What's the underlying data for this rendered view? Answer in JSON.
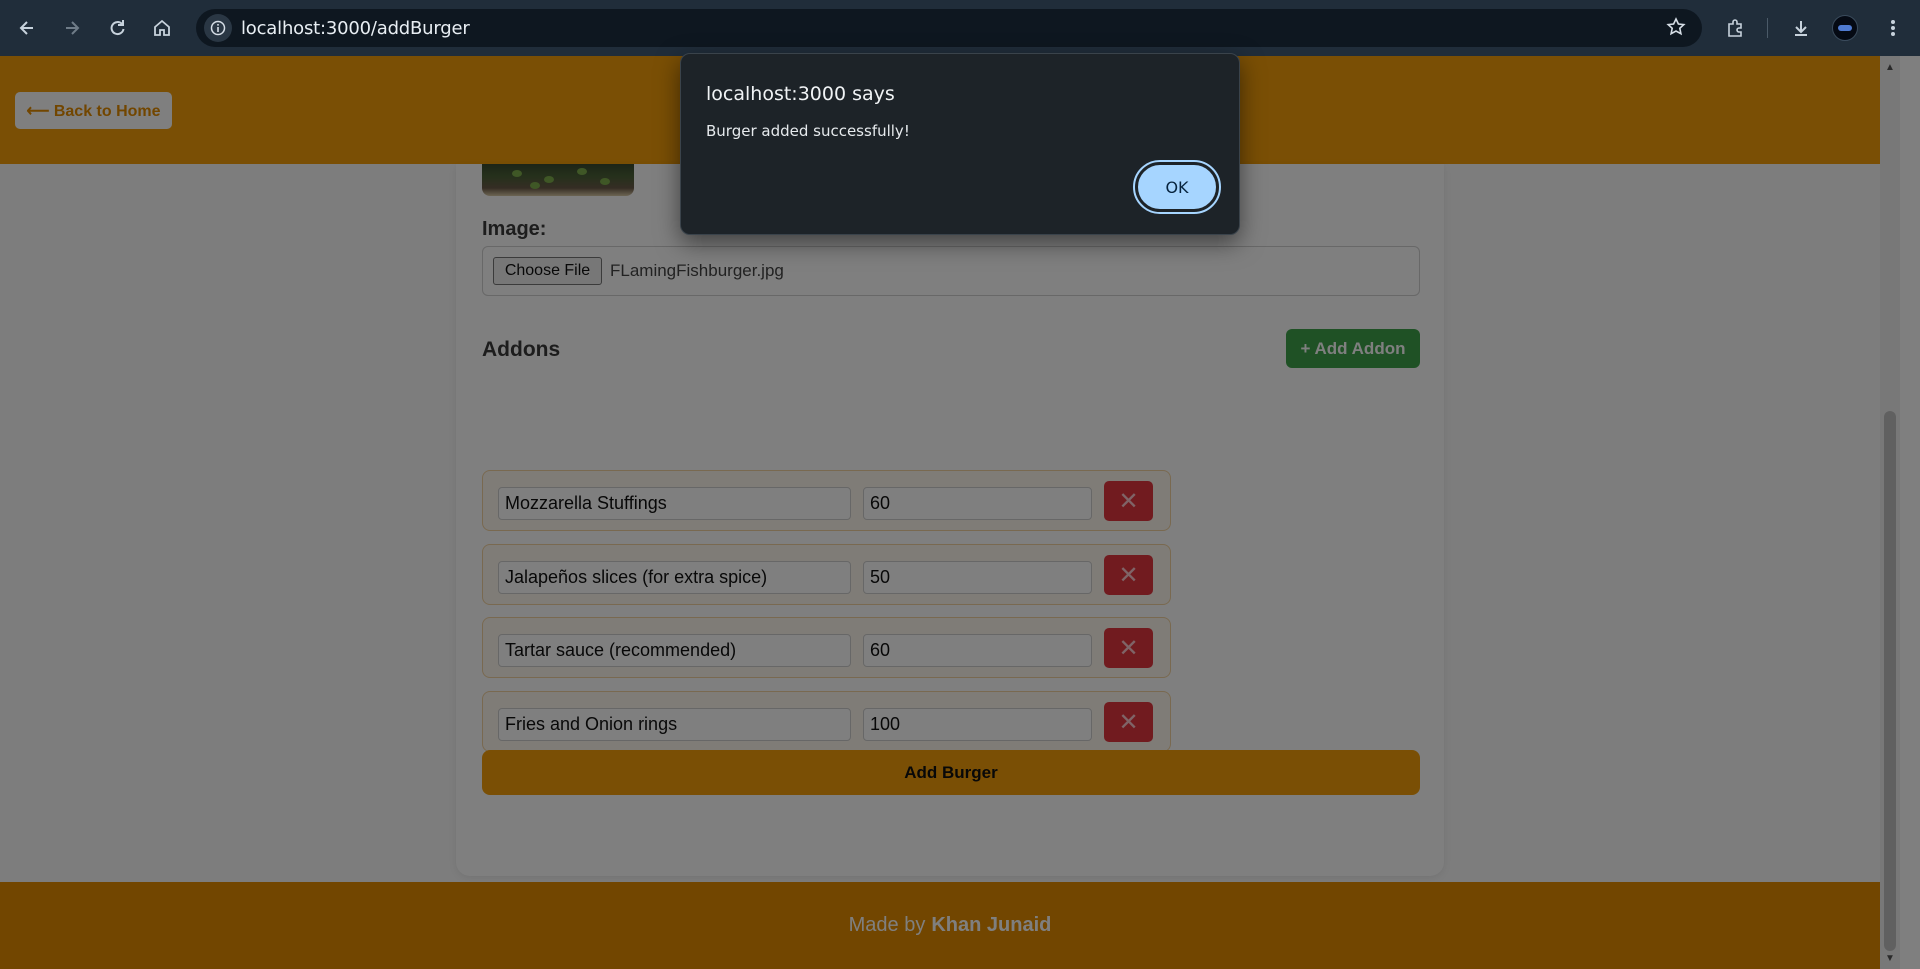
{
  "browser": {
    "url": "localhost:3000/addBurger",
    "back_icon": "arrow-left",
    "forward_icon": "arrow-right",
    "reload_icon": "reload",
    "home_icon": "home",
    "site_info_icon": "info",
    "bookmark_icon": "star",
    "extensions_icon": "puzzle",
    "downloads_icon": "download",
    "menu_icon": "kebab"
  },
  "header": {
    "back_label": "⟵ Back to Home"
  },
  "form": {
    "image_label": "Image:",
    "choose_file_label": "Choose File",
    "file_name": "FLamingFishburger.jpg",
    "addons_title": "Addons",
    "add_addon_label": "+ Add Addon",
    "addons": [
      {
        "name": "Mozzarella Stuffings",
        "price": "60"
      },
      {
        "name": "Jalapeños slices (for extra spice)",
        "price": "50"
      },
      {
        "name": "Tartar sauce (recommended)",
        "price": "60"
      },
      {
        "name": "Fries and Onion rings",
        "price": "100"
      }
    ],
    "delete_symbol": "✕",
    "submit_label": "Add Burger"
  },
  "footer": {
    "prefix": "Made by",
    "author": "Khan Junaid"
  },
  "dialog": {
    "title": "localhost:3000 says",
    "message": "Burger added successfully!",
    "ok_label": "OK"
  },
  "colors": {
    "brand_orange": "#f59f0a",
    "add_addon_green": "#3ea34a",
    "delete_red": "#e2373f",
    "dialog_bg": "#1d2328",
    "ok_button": "#a6d5ff"
  }
}
